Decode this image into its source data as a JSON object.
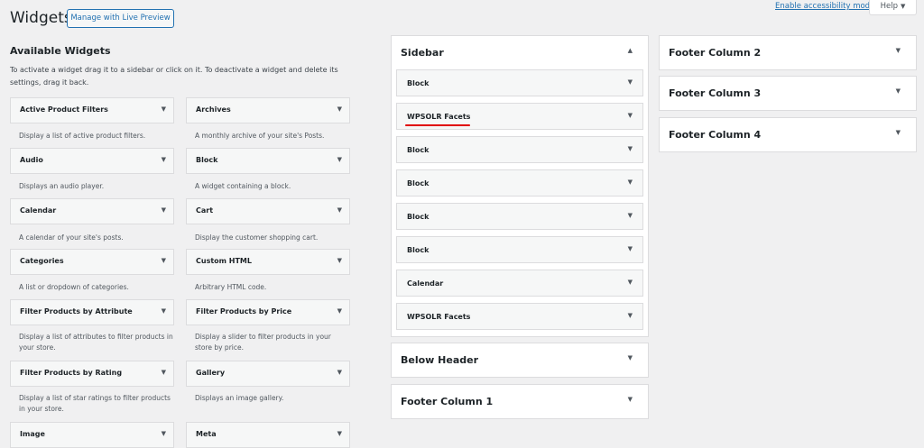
{
  "header": {
    "title": "Widgets",
    "live_preview_label": "Manage with Live Preview",
    "accessibility_link": "Enable accessibility mode",
    "help_label": "Help"
  },
  "available": {
    "title": "Available Widgets",
    "description": "To activate a widget drag it to a sidebar or click on it. To deactivate a widget and delete its settings, drag it back.",
    "widgets": [
      {
        "title": "Active Product Filters",
        "desc": "Display a list of active product filters."
      },
      {
        "title": "Archives",
        "desc": "A monthly archive of your site's Posts."
      },
      {
        "title": "Audio",
        "desc": "Displays an audio player."
      },
      {
        "title": "Block",
        "desc": "A widget containing a block."
      },
      {
        "title": "Calendar",
        "desc": "A calendar of your site's posts."
      },
      {
        "title": "Cart",
        "desc": "Display the customer shopping cart."
      },
      {
        "title": "Categories",
        "desc": "A list or dropdown of categories."
      },
      {
        "title": "Custom HTML",
        "desc": "Arbitrary HTML code."
      },
      {
        "title": "Filter Products by Attribute",
        "desc": "Display a list of attributes to filter products in your store."
      },
      {
        "title": "Filter Products by Price",
        "desc": "Display a slider to filter products in your store by price."
      },
      {
        "title": "Filter Products by Rating",
        "desc": "Display a list of star ratings to filter products in your store."
      },
      {
        "title": "Gallery",
        "desc": "Displays an image gallery."
      },
      {
        "title": "Image",
        "desc": ""
      },
      {
        "title": "Meta",
        "desc": ""
      }
    ]
  },
  "sidebar": {
    "title": "Sidebar",
    "widgets": [
      "Block",
      "WPSOLR Facets",
      "Block",
      "Block",
      "Block",
      "Block",
      "Calendar",
      "WPSOLR Facets"
    ]
  },
  "areas": {
    "below_header": "Below Header",
    "footer_1": "Footer Column 1",
    "footer_2": "Footer Column 2",
    "footer_3": "Footer Column 3",
    "footer_4": "Footer Column 4"
  },
  "icons": {
    "toggle_down": "▼",
    "toggle_up": "▲"
  },
  "colors": {
    "accent": "#2271b1",
    "highlight": "#e00000"
  }
}
